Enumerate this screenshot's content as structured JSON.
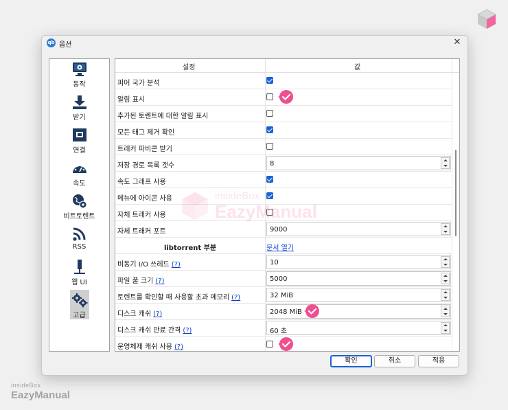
{
  "window": {
    "title": "옵션",
    "app_badge": "qb"
  },
  "sidebar": {
    "items": [
      {
        "label": "동작",
        "icon": "monitor-gear-icon"
      },
      {
        "label": "받기",
        "icon": "download-icon"
      },
      {
        "label": "연결",
        "icon": "network-icon"
      },
      {
        "label": "속도",
        "icon": "speedometer-icon"
      },
      {
        "label": "비트토렌트",
        "icon": "globe-gear-icon"
      },
      {
        "label": "RSS",
        "icon": "rss-icon"
      },
      {
        "label": "웹 UI",
        "icon": "webui-plug-icon"
      },
      {
        "label": "고급",
        "icon": "gears-icon"
      }
    ],
    "active": "고급"
  },
  "grid": {
    "headers": {
      "setting": "설정",
      "value": "값"
    },
    "rows": [
      {
        "key": "피어 국가 분석",
        "type": "checkbox",
        "checked": true
      },
      {
        "key": "알림 표시",
        "type": "checkbox",
        "checked": false,
        "marked": true
      },
      {
        "key": "추가된 토렌트에 대한 알림 표시",
        "type": "checkbox",
        "checked": false
      },
      {
        "key": "모든 태그 제거 확인",
        "type": "checkbox",
        "checked": true
      },
      {
        "key": "트래커 파비콘 받기",
        "type": "checkbox",
        "checked": false
      },
      {
        "key": "저장 경로 목록 갯수",
        "type": "spin",
        "value": "8"
      },
      {
        "key": "속도 그래프 사용",
        "type": "checkbox",
        "checked": true
      },
      {
        "key": "메뉴에 아이콘 사용",
        "type": "checkbox",
        "checked": true
      },
      {
        "key": "자체 트래커 사용",
        "type": "checkbox",
        "checked": false
      },
      {
        "key": "자체 트래커 포트",
        "type": "spin",
        "value": "9000"
      },
      {
        "key": "libtorrent 부분",
        "type": "section",
        "link": "문서 열기"
      },
      {
        "key": "비동기 I/O 쓰레드",
        "help": "(?)",
        "type": "spin",
        "value": "10"
      },
      {
        "key": "파일 풀 크기",
        "help": "(?)",
        "type": "spin",
        "value": "5000"
      },
      {
        "key": "토렌트를 확인할 때 사용할 초과 메모리",
        "help": "(?)",
        "type": "spin",
        "value": "32 MiB"
      },
      {
        "key": "디스크 캐쉬",
        "help": "(?)",
        "type": "spin",
        "value": "2048 MiB",
        "marked": true
      },
      {
        "key": "디스크 캐쉬 만료 간격",
        "help": "(?)",
        "type": "spin",
        "value": "60 초"
      },
      {
        "key": "운영체제 캐쉬 사용",
        "help": "(?)",
        "type": "checkbox",
        "checked": false,
        "marked": true
      }
    ]
  },
  "buttons": {
    "ok": "확인",
    "cancel": "취소",
    "apply": "적용"
  },
  "watermark": {
    "top": "insideBox",
    "bottom": "EazyManual",
    "center_top": "insideBox",
    "center_bottom": "EazyManual"
  },
  "colors": {
    "accent": "#1a62d6",
    "marker": "#ef4f8f",
    "link": "#0a3fcc"
  }
}
